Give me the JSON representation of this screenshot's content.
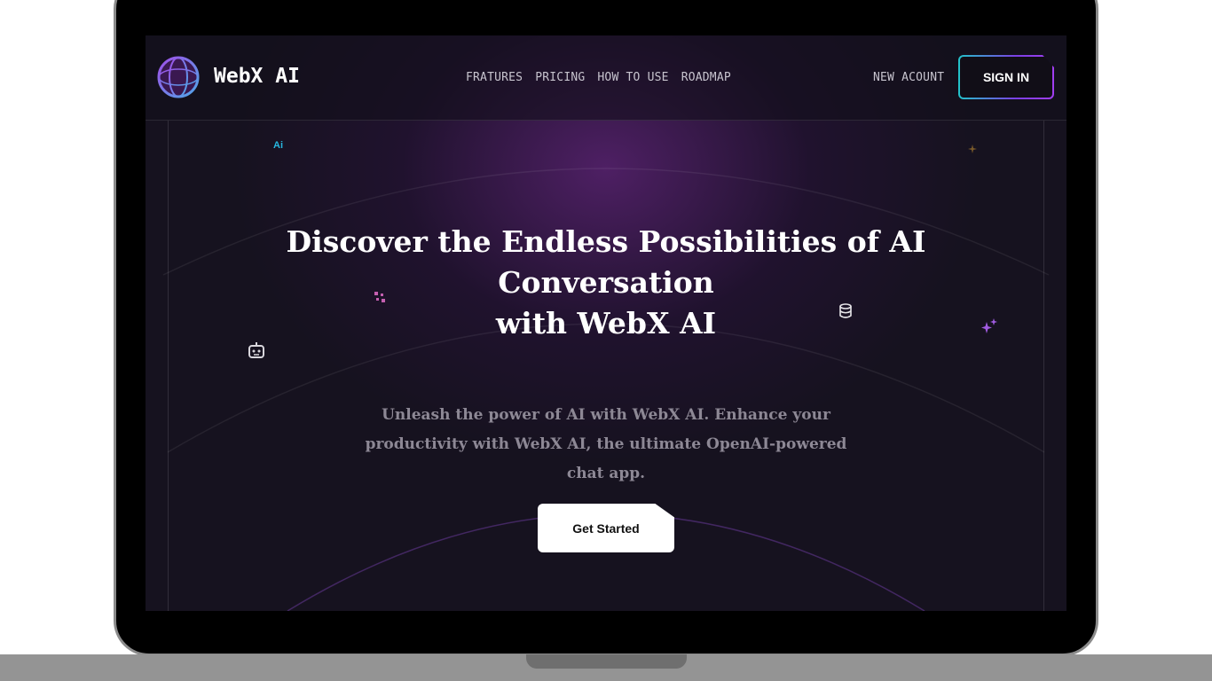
{
  "brand": {
    "name": "WebX AI"
  },
  "nav": {
    "items": [
      "FRATURES",
      "PRICING",
      "HOW TO USE",
      "ROADMAP"
    ],
    "new_account": "NEW ACOUNT",
    "sign_in": "SIGN IN"
  },
  "hero": {
    "title_line1": "Discover the Endless Possibilities of AI Conversation",
    "title_line2": "with WebX AI",
    "subtitle": "Unleash the power of AI with WebX AI. Enhance your productivity with WebX AI, the ultimate OpenAI-powered chat app.",
    "cta": "Get Started"
  },
  "decorations": {
    "ai_badge": "Ai",
    "icons": [
      "ai-badge-icon",
      "small-star-icon",
      "sparkle-dots-icon",
      "robot-icon",
      "database-icon",
      "sparkles-icon"
    ]
  },
  "colors": {
    "background": "#16121f",
    "accent_teal": "#22c3c9",
    "accent_purple": "#7b3fe4",
    "text_muted": "#8d8895"
  }
}
